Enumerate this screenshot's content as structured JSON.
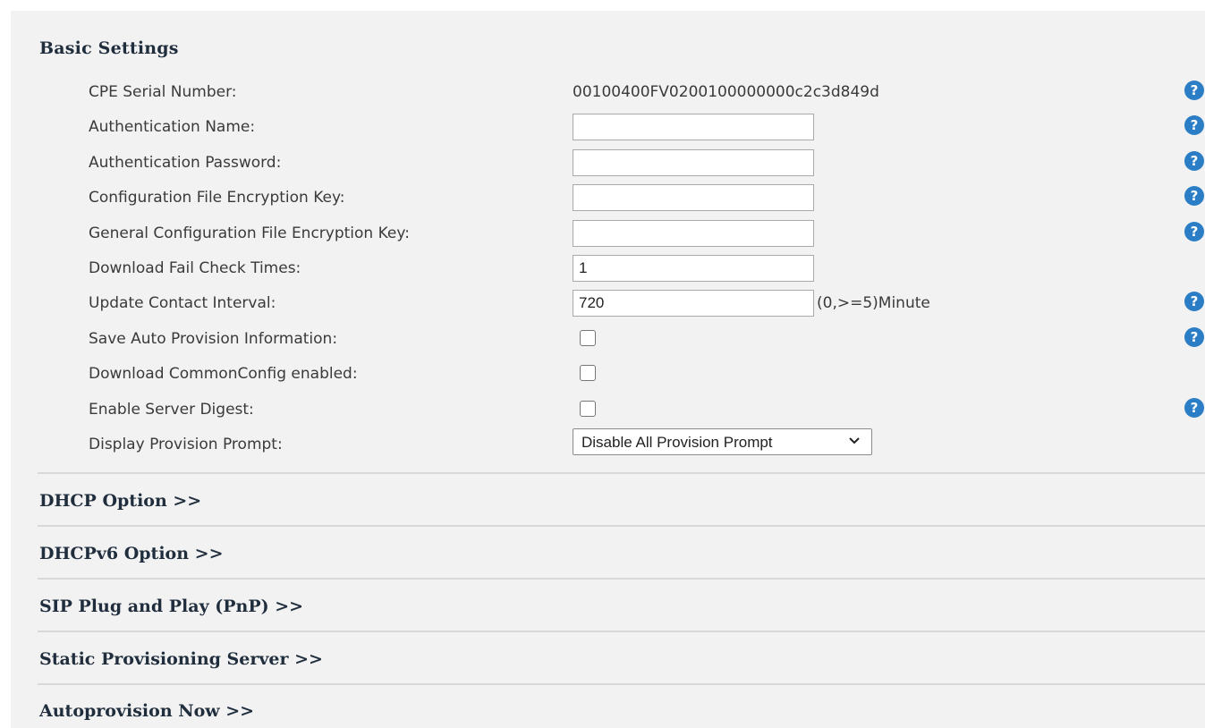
{
  "basic": {
    "title": "Basic Settings",
    "cpe_serial": {
      "label": "CPE Serial Number:",
      "value": "00100400FV0200100000000c2c3d849d"
    },
    "auth_name": {
      "label": "Authentication Name:",
      "value": ""
    },
    "auth_password": {
      "label": "Authentication Password:",
      "value": ""
    },
    "config_key": {
      "label": "Configuration File Encryption Key:",
      "value": ""
    },
    "general_config_key": {
      "label": "General Configuration File Encryption Key:",
      "value": ""
    },
    "download_fail": {
      "label": "Download Fail Check Times:",
      "value": "1"
    },
    "update_interval": {
      "label": "Update Contact Interval:",
      "value": "720",
      "unit": "(0,>=5)Minute"
    },
    "save_auto_provision": {
      "label": "Save Auto Provision Information:",
      "checked": false
    },
    "download_commonconfig": {
      "label": "Download CommonConfig enabled:",
      "checked": false
    },
    "server_digest": {
      "label": "Enable Server Digest:",
      "checked": false
    },
    "display_prompt": {
      "label": "Display Provision Prompt:",
      "selected": "Disable All Provision Prompt"
    }
  },
  "help_glyph": "?",
  "icons": {
    "help": "question-circle-icon",
    "dropdown": "chevron-down-icon"
  },
  "colors": {
    "help_icon": "#2b7ec5",
    "panel_bg": "#f2f2f2",
    "heading": "#1f2d3d"
  },
  "collapsed_sections": [
    "DHCP Option >>",
    "DHCPv6 Option >>",
    "SIP Plug and Play (PnP) >>",
    "Static Provisioning Server >>",
    "Autoprovision Now >>"
  ]
}
